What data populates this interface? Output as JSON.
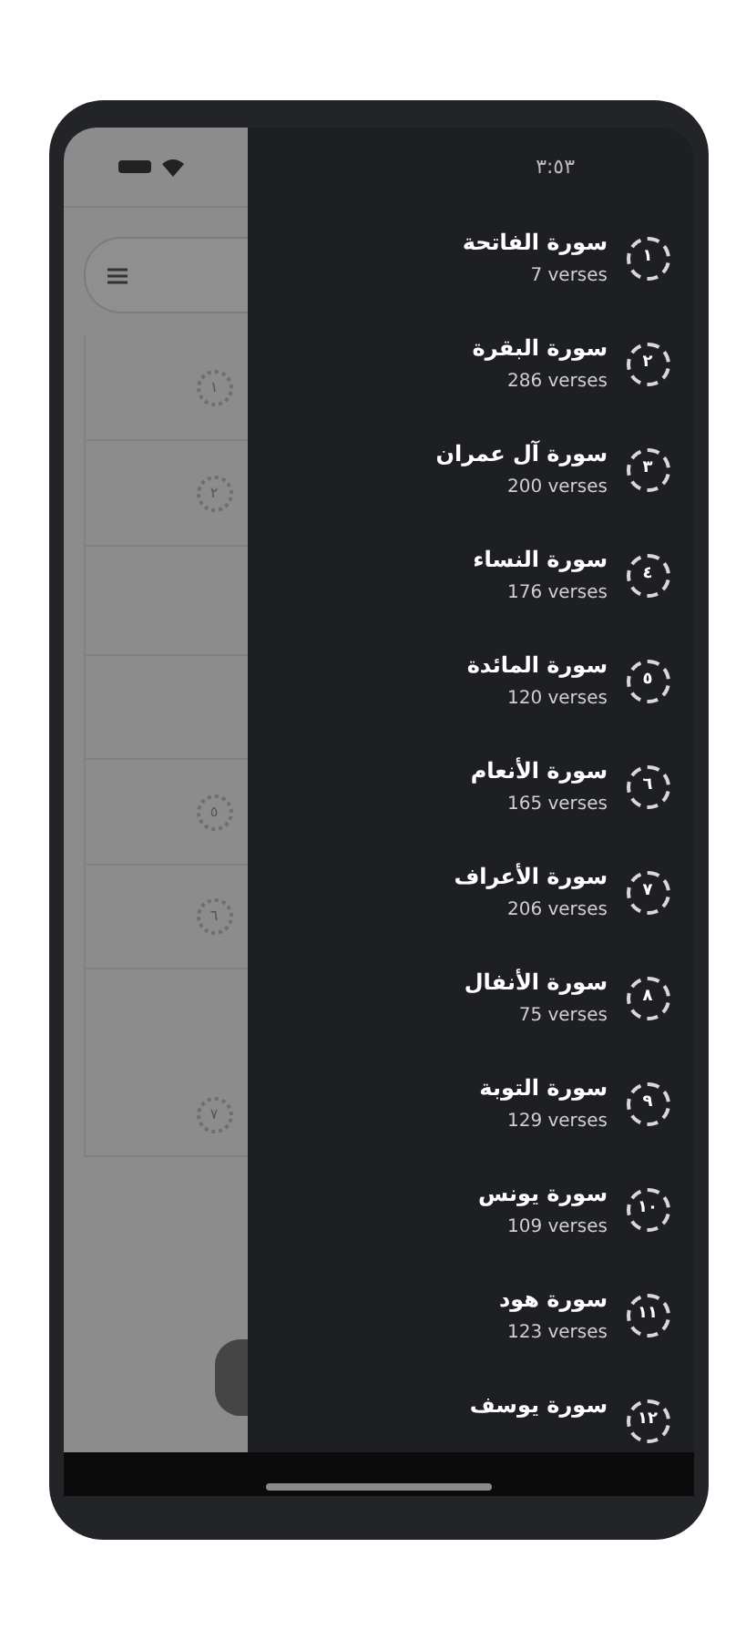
{
  "background_page": {
    "rows": [
      {
        "kind": "marker",
        "number": "١"
      },
      {
        "kind": "marker",
        "number": "٢"
      },
      {
        "kind": "blank"
      },
      {
        "kind": "blank"
      },
      {
        "kind": "marker",
        "number": "٥"
      },
      {
        "kind": "marker",
        "number": "٦"
      },
      {
        "kind": "marker",
        "number": "٧"
      }
    ]
  },
  "drawer": {
    "time": "٣:٥٣",
    "surahs": [
      {
        "number": "١",
        "name": "سورة الفاتحة",
        "verses": "7 verses"
      },
      {
        "number": "٢",
        "name": "سورة البقرة",
        "verses": "286 verses"
      },
      {
        "number": "٣",
        "name": "سورة آل عمران",
        "verses": "200 verses"
      },
      {
        "number": "٤",
        "name": "سورة النساء",
        "verses": "176 verses"
      },
      {
        "number": "٥",
        "name": "سورة المائدة",
        "verses": "120 verses"
      },
      {
        "number": "٦",
        "name": "سورة الأنعام",
        "verses": "165 verses"
      },
      {
        "number": "٧",
        "name": "سورة الأعراف",
        "verses": "206 verses"
      },
      {
        "number": "٨",
        "name": "سورة الأنفال",
        "verses": "75 verses"
      },
      {
        "number": "٩",
        "name": "سورة التوبة",
        "verses": "129 verses"
      },
      {
        "number": "١٠",
        "name": "سورة يونس",
        "verses": "109 verses"
      },
      {
        "number": "١١",
        "name": "سورة هود",
        "verses": "123 verses"
      },
      {
        "number": "١٢",
        "name": "سورة يوسف"
      }
    ]
  }
}
